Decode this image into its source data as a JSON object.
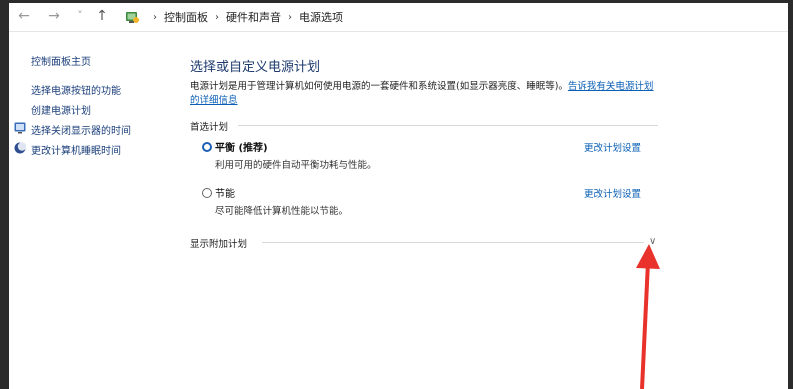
{
  "nav": {
    "back_icon": "←",
    "forward_icon": "→",
    "dropdown_icon": "˅",
    "up_icon": "↑",
    "breadcrumbs": [
      "控制面板",
      "硬件和声音",
      "电源选项"
    ],
    "separator": "›"
  },
  "sidebar": {
    "home": "控制面板主页",
    "items": [
      "选择电源按钮的功能",
      "创建电源计划",
      "选择关闭显示器的时间",
      "更改计算机睡眠时间"
    ]
  },
  "main": {
    "title": "选择或自定义电源计划",
    "description": "电源计划是用于管理计算机如何使用电源的一套硬件和系统设置(如显示器亮度、睡眠等)。",
    "link": "告诉我有关电源计划的详细信息",
    "preferred_label": "首选计划",
    "plans": [
      {
        "name": "平衡 (推荐)",
        "description": "利用可用的硬件自动平衡功耗与性能。",
        "change": "更改计划设置",
        "selected": true
      },
      {
        "name": "节能",
        "description": "尽可能降低计算机性能以节能。",
        "change": "更改计划设置",
        "selected": false
      }
    ],
    "show_additional": "显示附加计划",
    "chevron_icon": "∨"
  },
  "colors": {
    "arrow": "#e8322b",
    "link": "#0b5fb5",
    "title": "#1e3a6e"
  }
}
